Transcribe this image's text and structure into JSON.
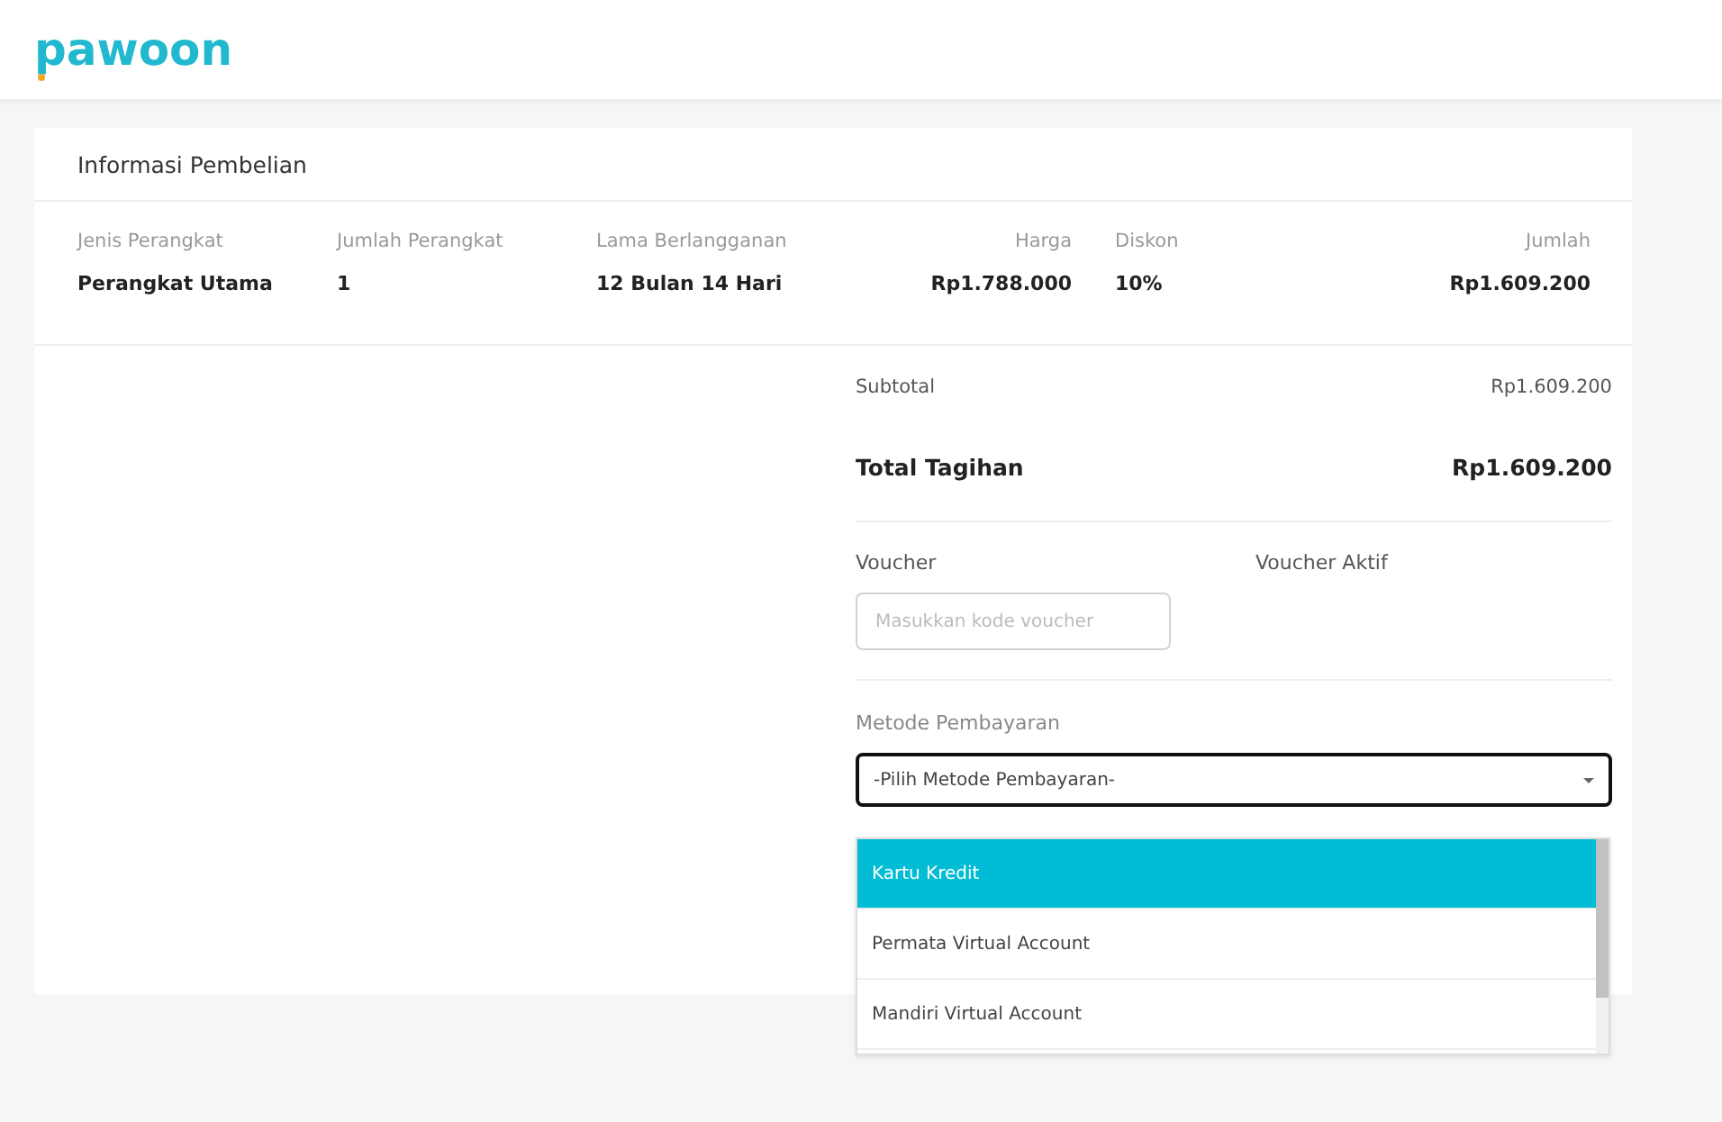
{
  "header": {
    "logo": "pawoon"
  },
  "card": {
    "title": "Informasi Pembelian",
    "table": {
      "columns": [
        {
          "label": "Jenis Perangkat",
          "kind": "text"
        },
        {
          "label": "Jumlah Perangkat",
          "kind": "text"
        },
        {
          "label": "Lama Berlangganan",
          "kind": "text"
        },
        {
          "label": "Harga",
          "kind": "amount"
        },
        {
          "label": "Diskon",
          "kind": "text"
        },
        {
          "label": "Jumlah",
          "kind": "amount"
        }
      ],
      "rows": [
        [
          "Perangkat Utama",
          "1",
          "12 Bulan 14 Hari",
          "Rp1.788.000",
          "10%",
          "Rp1.609.200"
        ]
      ]
    },
    "subtotal": {
      "label": "Subtotal",
      "value": "Rp1.609.200"
    },
    "total": {
      "label": "Total Tagihan",
      "value": "Rp1.609.200"
    },
    "voucher": {
      "label": "Voucher",
      "placeholder": "Masukkan kode voucher",
      "active_label": "Voucher Aktif"
    },
    "payment": {
      "label": "Metode Pembayaran",
      "select_value": "-Pilih Metode Pembayaran-",
      "expanded": true,
      "options": [
        {
          "label": "Kartu Kredit",
          "selected": true
        },
        {
          "label": "Permata Virtual Account",
          "selected": false
        },
        {
          "label": "Mandiri Virtual Account",
          "selected": false
        }
      ]
    }
  }
}
